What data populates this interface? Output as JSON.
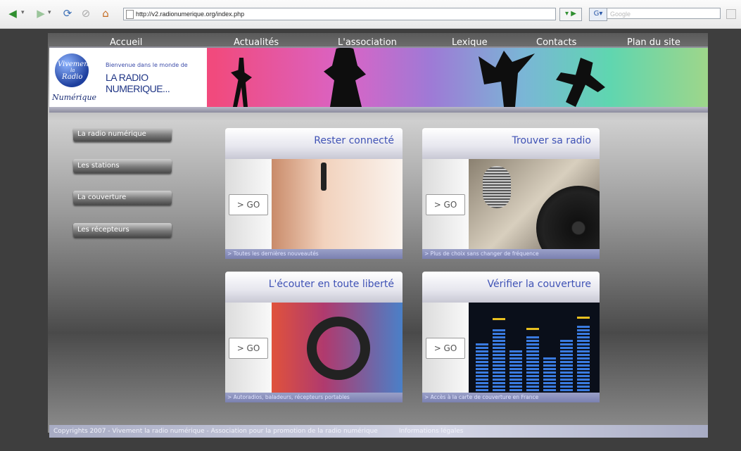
{
  "browser": {
    "url": "http://v2.radionumerique.org/index.php",
    "search_placeholder": "Google",
    "icons": [
      "back-arrow-icon",
      "forward-arrow-icon",
      "refresh-icon",
      "stop-icon",
      "home-icon",
      "page-icon",
      "go-icon",
      "search-engine-icon"
    ]
  },
  "nav": {
    "items": [
      "Accueil",
      "Actualités",
      "L'association",
      "Lexique",
      "Contacts",
      "Plan du site"
    ]
  },
  "banner": {
    "logo_top": "Vivement",
    "logo_mid": "la",
    "logo_radio": "Radio",
    "logo_bottom": "Numérique",
    "welcome": "Bienvenue dans le monde de",
    "title": "LA RADIO NUMERIQUE..."
  },
  "sidebar": {
    "items": [
      "La radio numérique",
      "Les stations",
      "La couverture",
      "Les récepteurs"
    ]
  },
  "cards": [
    {
      "title": "Rester connecté",
      "go": "> GO",
      "caption": "> Toutes les dernières nouveautés"
    },
    {
      "title": "Trouver sa radio",
      "go": "> GO",
      "caption": "> Plus de choix sans changer de fréquence"
    },
    {
      "title": "L'écouter en toute liberté",
      "go": "> GO",
      "caption": "> Autoradios, baladeurs, récepteurs portables"
    },
    {
      "title": "Vérifier la couverture",
      "go": "> GO",
      "caption": "> Accès à la carte de couverture en France"
    }
  ],
  "footer": {
    "copyright": "Copyrights 2007 - Vivement la radio numérique - Association pour la promotion de la radio numérique",
    "legal": "Informations légales"
  },
  "colors": {
    "accent_title": "#3f52b5",
    "banner_pink": "#f14a7d",
    "banner_green": "#5fd6b0"
  }
}
